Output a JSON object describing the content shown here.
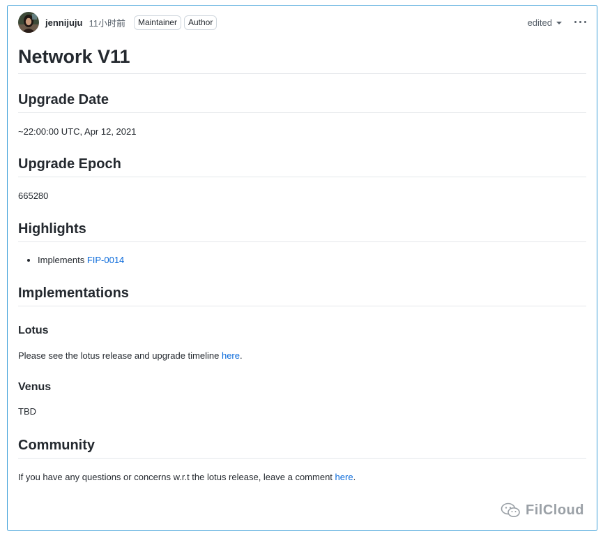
{
  "comment": {
    "author": "jennijuju",
    "time": "11小时前",
    "badges": [
      "Maintainer",
      "Author"
    ],
    "edited_label": "edited",
    "menu_icon": "kebab-horizontal-icon",
    "avatar_icon": "user-avatar"
  },
  "body": {
    "title": "Network V11",
    "upgrade_date": {
      "heading": "Upgrade Date",
      "text": "~22:00:00 UTC, Apr 12, 2021"
    },
    "upgrade_epoch": {
      "heading": "Upgrade Epoch",
      "text": "665280"
    },
    "highlights": {
      "heading": "Highlights",
      "items": [
        {
          "prefix": "Implements ",
          "link": "FIP-0014"
        }
      ]
    },
    "implementations": {
      "heading": "Implementations",
      "lotus": {
        "heading": "Lotus",
        "text_before": "Please see the lotus release and upgrade timeline ",
        "link": "here",
        "text_after": "."
      },
      "venus": {
        "heading": "Venus",
        "text": "TBD"
      }
    },
    "community": {
      "heading": "Community",
      "text_before": "If you have any questions or concerns w.r.t the lotus release, leave a comment ",
      "link": "here",
      "text_after": "."
    }
  },
  "watermark": {
    "text": "FilCloud",
    "icon": "wechat-icon"
  },
  "colors": {
    "link": "#0969da",
    "card_border": "#3fa0d9",
    "text": "#24292f",
    "muted": "#57606a"
  }
}
